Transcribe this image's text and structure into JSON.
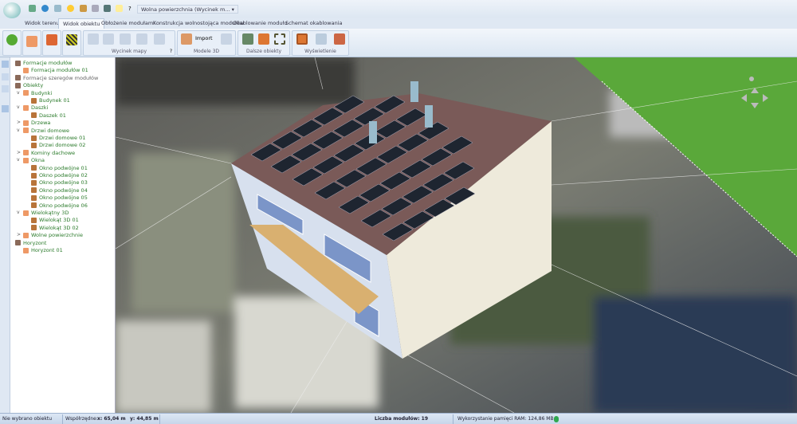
{
  "titlebar": {
    "document": "Wolna powierzchnia (Wycinek m...",
    "help": "?",
    "dropdown": "▾"
  },
  "tabs": [
    "Widok terenu",
    "Widok obiektu",
    "Obłożenie modułami",
    "Konstrukcja wolnostojąca modułów",
    "Okablowanie modułu",
    "Schemat okablowania"
  ],
  "active_tab": "Widok obiektu",
  "ribbon": {
    "groups": [
      "Wycinek mapy",
      "Modele 3D",
      "Dalsze obiekty",
      "Wyświetlenie"
    ],
    "import_label": "Import",
    "help": "?"
  },
  "tree": [
    {
      "label": "Formacje modułów",
      "level": 0,
      "color": "green"
    },
    {
      "label": "Formacja modułów 01",
      "level": 1,
      "color": "green"
    },
    {
      "label": "Formacje szeregów modułów",
      "level": 0,
      "color": "gray"
    },
    {
      "label": "Obiekty",
      "level": 0,
      "color": "green"
    },
    {
      "label": "Budynki",
      "level": 1,
      "color": "green",
      "exp": "v"
    },
    {
      "label": "Budynek 01",
      "level": 2,
      "color": "green"
    },
    {
      "label": "Daszki",
      "level": 1,
      "color": "green",
      "exp": "v"
    },
    {
      "label": "Daszek 01",
      "level": 2,
      "color": "green"
    },
    {
      "label": "Drzewa",
      "level": 1,
      "color": "green",
      "exp": ">"
    },
    {
      "label": "Drzwi domowe",
      "level": 1,
      "color": "green",
      "exp": "v"
    },
    {
      "label": "Drzwi domowe 01",
      "level": 2,
      "color": "green"
    },
    {
      "label": "Drzwi domowe 02",
      "level": 2,
      "color": "green"
    },
    {
      "label": "Kominy dachowe",
      "level": 1,
      "color": "green",
      "exp": ">"
    },
    {
      "label": "Okna",
      "level": 1,
      "color": "green",
      "exp": "v"
    },
    {
      "label": "Okno podwójne 01",
      "level": 2,
      "color": "green"
    },
    {
      "label": "Okno podwójne 02",
      "level": 2,
      "color": "green"
    },
    {
      "label": "Okno podwójne 03",
      "level": 2,
      "color": "green"
    },
    {
      "label": "Okno podwójne 04",
      "level": 2,
      "color": "green"
    },
    {
      "label": "Okno podwójne 05",
      "level": 2,
      "color": "green"
    },
    {
      "label": "Okno podwójne 06",
      "level": 2,
      "color": "green"
    },
    {
      "label": "Wielokątny 3D",
      "level": 1,
      "color": "green",
      "exp": "v"
    },
    {
      "label": "Wielokąt 3D 01",
      "level": 2,
      "color": "green"
    },
    {
      "label": "Wielokąt 3D 02",
      "level": 2,
      "color": "green"
    },
    {
      "label": "Wolne powierzchnie",
      "level": 1,
      "color": "green",
      "exp": ">"
    },
    {
      "label": "Horyzont",
      "level": 0,
      "color": "green"
    },
    {
      "label": "Horyzont 01",
      "level": 1,
      "color": "green"
    }
  ],
  "status": {
    "selection": "Nie wybrano obiektu",
    "coords_label": "Współrzędne:",
    "x": "x: 65,04 m",
    "y": "y: 44,85 m",
    "modules": "Liczba modułów: 19",
    "ram": "Wykorzystanie pamięci RAM: 124,86 MB",
    "status_color": "#2fa84f"
  },
  "colors": {
    "grass": "#5aa83a",
    "roof": "#7a5a58",
    "panel": "#1e2530",
    "wall_left": "#d7e0ee",
    "wall_right": "#eeeadb",
    "balcony": "#d9b070"
  }
}
